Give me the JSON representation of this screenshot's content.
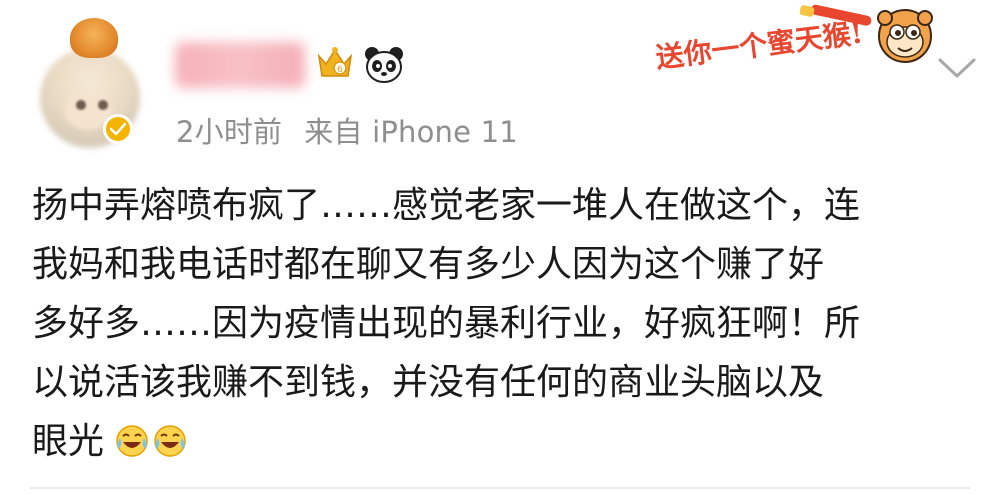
{
  "post": {
    "timestamp": "2小时前",
    "source": "来自 iPhone 11",
    "sticker_text": "送你一个蜜天猴!",
    "content_lines": [
      "扬中弄熔喷布疯了……感觉老家一堆人在做这个，连",
      "我妈和我电话时都在聊又有多少人因为这个赚了好",
      "多好多……因为疫情出现的暴利行业，好疯狂啊！所",
      "以说活该我赚不到钱，并没有任何的商业头脑以及",
      "眼光"
    ],
    "trailing_emojis": [
      "laugh-cry-icon",
      "laugh-cry-icon"
    ]
  },
  "icons": {
    "verified_badge": "vip-badge-icon",
    "member_badge": "crown-icon",
    "panda": "panda-icon",
    "menu": "chevron-down-icon"
  },
  "colors": {
    "meta_text": "#8e8e8e",
    "body_text": "#1a1a1a",
    "badge": "#f5b400",
    "sticker_text": "#e8462f"
  }
}
